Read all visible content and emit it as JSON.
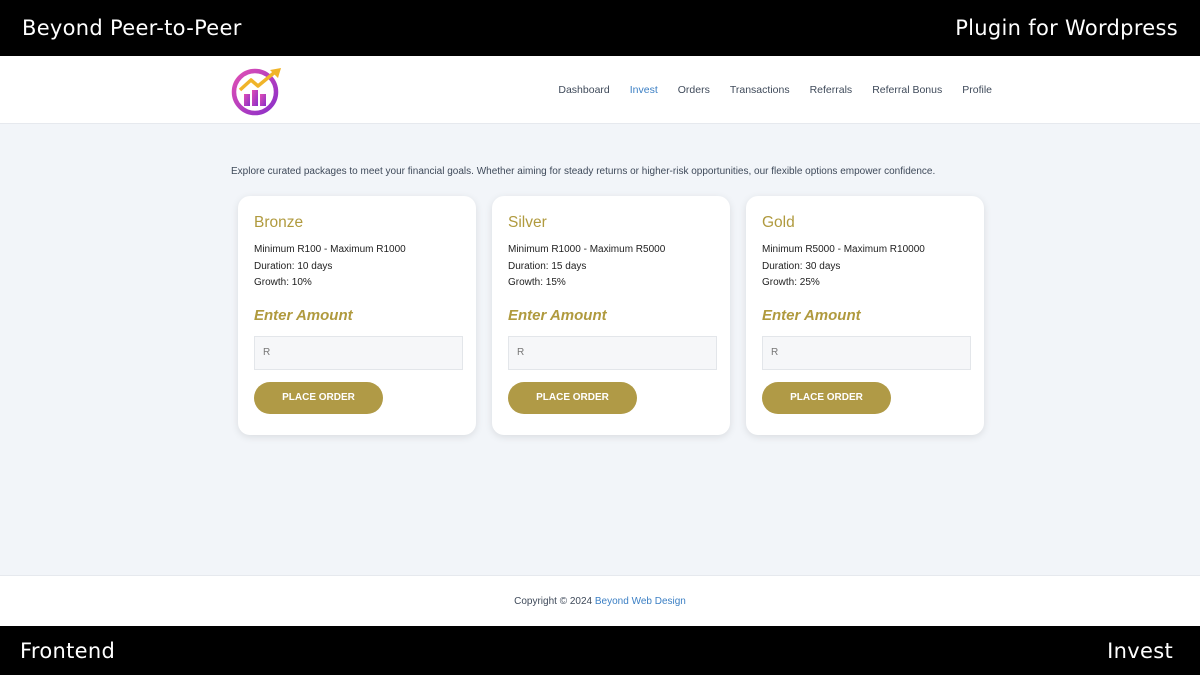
{
  "banner": {
    "top_left": "Beyond Peer-to-Peer",
    "top_right": "Plugin for Wordpress",
    "bottom_left": "Frontend",
    "bottom_right": "Invest"
  },
  "nav": {
    "items": [
      {
        "label": "Dashboard"
      },
      {
        "label": "Invest"
      },
      {
        "label": "Orders"
      },
      {
        "label": "Transactions"
      },
      {
        "label": "Referrals"
      },
      {
        "label": "Referral Bonus"
      },
      {
        "label": "Profile"
      }
    ],
    "active": "Invest"
  },
  "intro": "Explore curated packages to meet your financial goals. Whether aiming for steady returns or higher-risk opportunities, our flexible options empower confidence.",
  "packages": [
    {
      "title": "Bronze",
      "range": "Minimum R100 - Maximum R1000",
      "duration": "Duration: 10 days",
      "growth": "Growth: 10%",
      "enter_label": "Enter Amount",
      "placeholder": "R",
      "button": "PLACE ORDER"
    },
    {
      "title": "Silver",
      "range": "Minimum R1000 - Maximum R5000",
      "duration": "Duration: 15 days",
      "growth": "Growth: 15%",
      "enter_label": "Enter Amount",
      "placeholder": "R",
      "button": "PLACE ORDER"
    },
    {
      "title": "Gold",
      "range": "Minimum R5000 - Maximum R10000",
      "duration": "Duration: 30 days",
      "growth": "Growth: 25%",
      "enter_label": "Enter Amount",
      "placeholder": "R",
      "button": "PLACE ORDER"
    }
  ],
  "footer": {
    "copyright": "Copyright © 2024 ",
    "link": "Beyond Web Design"
  },
  "colors": {
    "accent_gold": "#b09a3e",
    "button_gold": "#b09a46",
    "link_blue": "#3b7fc4",
    "background": "#f2f5f9"
  },
  "icons": {
    "logo": "growth-chart-logo-icon"
  }
}
